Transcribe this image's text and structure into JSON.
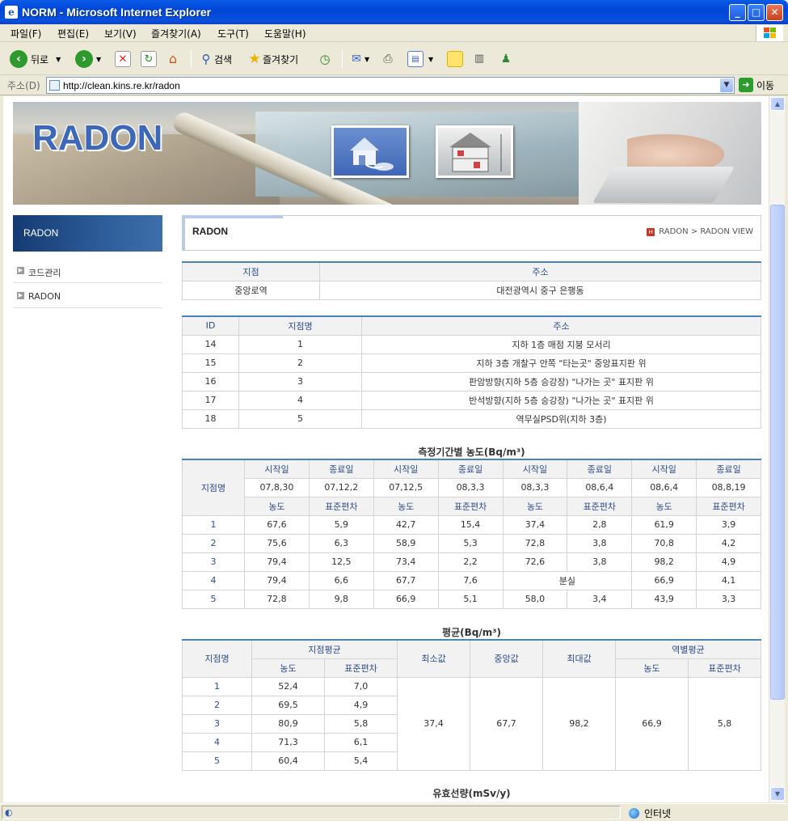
{
  "window": {
    "title": "NORM - Microsoft Internet Explorer"
  },
  "menu": [
    "파일(F)",
    "편집(E)",
    "보기(V)",
    "즐겨찾기(A)",
    "도구(T)",
    "도움말(H)"
  ],
  "toolbar": {
    "back": "뒤로",
    "search": "검색",
    "favorites": "즐겨찾기"
  },
  "address": {
    "label": "주소(D)",
    "url": "http://clean.kins.re.kr/radon",
    "go": "이동"
  },
  "status": {
    "zone": "인터넷"
  },
  "banner": {
    "logo": "RADON"
  },
  "nav": {
    "title": "RADON",
    "items": [
      "코드관리",
      "RADON"
    ]
  },
  "page": {
    "title": "RADON",
    "crumb": "RADON > RADON VIEW"
  },
  "site": {
    "headers": [
      "지점",
      "주소"
    ],
    "row": [
      "중앙로역",
      "대전광역시 중구 은행동"
    ]
  },
  "points": {
    "headers": [
      "ID",
      "지점명",
      "주소"
    ],
    "rows": [
      [
        "14",
        "1",
        "지하 1층 매점 지붕 모서리"
      ],
      [
        "15",
        "2",
        "지하 3층 개찰구 안쪽 \"타는곳\" 중앙표지판 위"
      ],
      [
        "16",
        "3",
        "판암방향(지하 5층 승강장) \"나가는 곳\" 표지판 위"
      ],
      [
        "17",
        "4",
        "반석방향(지하 5층 승강장) \"나가는 곳\" 표지판 위"
      ],
      [
        "18",
        "5",
        "역무실PSD위(지하 3층)"
      ]
    ]
  },
  "period": {
    "title": "측정기간별 농도(Bq/m³)",
    "point_label": "지점명",
    "start": "시작일",
    "end": "종료일",
    "dates": [
      "07,8,30",
      "07,12,2",
      "07,12,5",
      "08,3,3",
      "08,3,3",
      "08,6,4",
      "08,6,4",
      "08,8,19"
    ],
    "conc": "농도",
    "sd": "표준편차",
    "lost": "분실",
    "rows": [
      [
        "1",
        "67,6",
        "5,9",
        "42,7",
        "15,4",
        "37,4",
        "2,8",
        "61,9",
        "3,9"
      ],
      [
        "2",
        "75,6",
        "6,3",
        "58,9",
        "5,3",
        "72,8",
        "3,8",
        "70,8",
        "4,2"
      ],
      [
        "3",
        "79,4",
        "12,5",
        "73,4",
        "2,2",
        "72,6",
        "3,8",
        "98,2",
        "4,9"
      ],
      [
        "4",
        "79,4",
        "6,6",
        "67,7",
        "7,6",
        "",
        "",
        "66,9",
        "4,1"
      ],
      [
        "5",
        "72,8",
        "9,8",
        "66,9",
        "5,1",
        "58,0",
        "3,4",
        "43,9",
        "3,3"
      ]
    ]
  },
  "average": {
    "title": "평균(Bq/m³)",
    "point_label": "지점명",
    "point_avg": "지점평균",
    "min": "최소값",
    "median": "중앙값",
    "max": "최대값",
    "station_avg": "역별평균",
    "conc": "농도",
    "sd": "표준편차",
    "rows": [
      [
        "1",
        "52,4",
        "7,0"
      ],
      [
        "2",
        "69,5",
        "4,9"
      ],
      [
        "3",
        "80,9",
        "5,8"
      ],
      [
        "4",
        "71,3",
        "6,1"
      ],
      [
        "5",
        "60,4",
        "5,4"
      ]
    ],
    "min_val": "37,4",
    "median_val": "67,7",
    "max_val": "98,2",
    "station_conc": "66,9",
    "station_sd": "5,8"
  },
  "dose": {
    "title": "유효선량(mSv/y)"
  }
}
